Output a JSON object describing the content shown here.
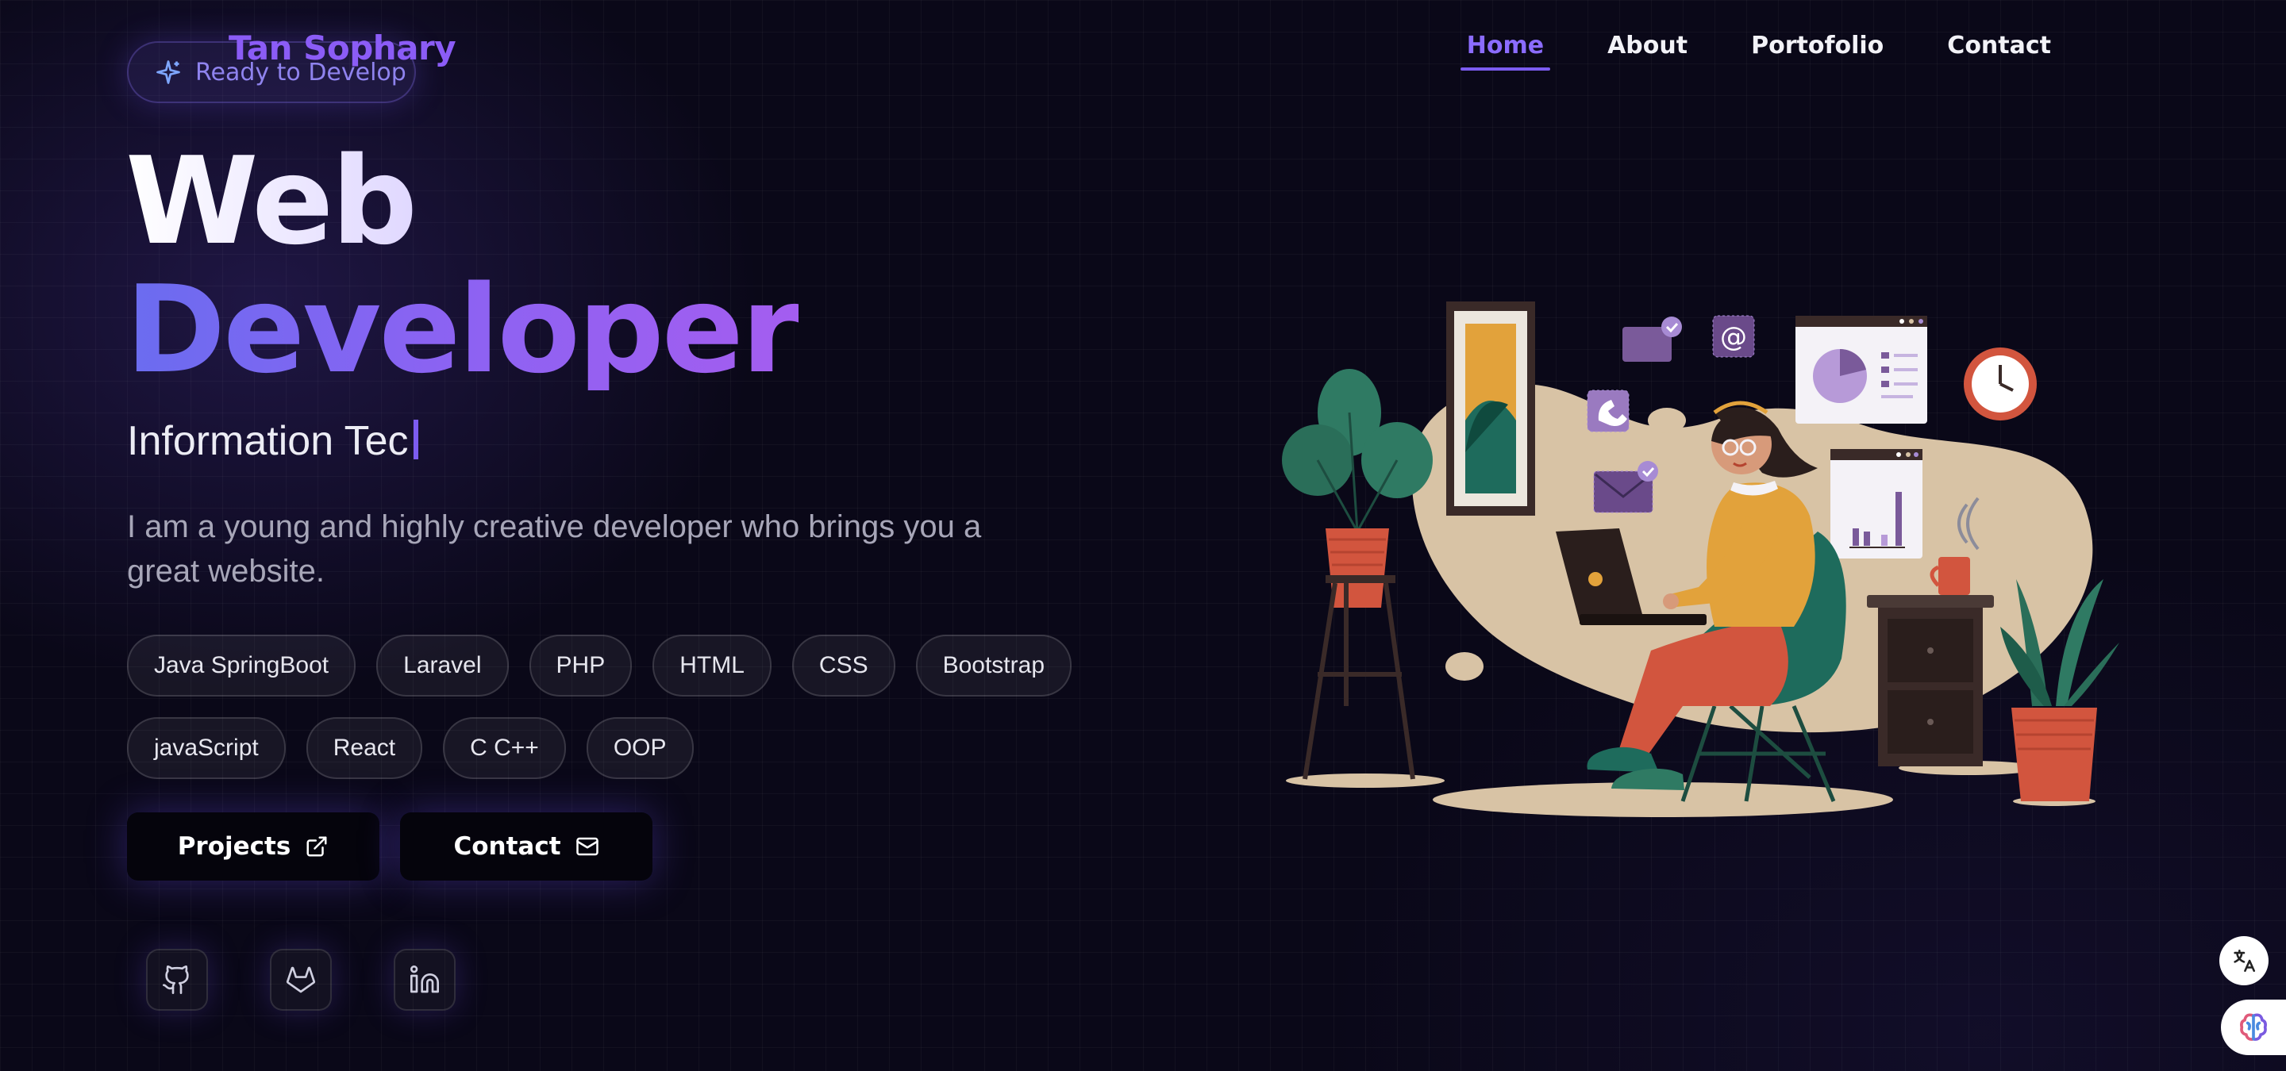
{
  "brand": {
    "name": "Tan Sophary"
  },
  "badge": {
    "label": "Ready to Develop",
    "icon": "sparkles-icon"
  },
  "nav": {
    "items": [
      {
        "label": "Home",
        "active": true
      },
      {
        "label": "About",
        "active": false
      },
      {
        "label": "Portofolio",
        "active": false
      },
      {
        "label": "Contact",
        "active": false
      }
    ]
  },
  "hero": {
    "title_line1": "Web",
    "title_line2": "Developer",
    "typing_text": "Information Tec",
    "description": "I am a young and highly creative developer who brings you a great website."
  },
  "skills": [
    "Java SpringBoot",
    "Laravel",
    "PHP",
    "HTML",
    "CSS",
    "Bootstrap",
    "javaScript",
    "React",
    "C C++",
    "OOP"
  ],
  "buttons": {
    "projects": "Projects",
    "contact": "Contact"
  },
  "social": [
    "github-icon",
    "gitlab-icon",
    "linkedin-icon"
  ],
  "colors": {
    "accent": "#7c5cf0",
    "background": "#0a0818",
    "gradient_start": "#6a6cf0",
    "gradient_end": "#a45df0"
  }
}
